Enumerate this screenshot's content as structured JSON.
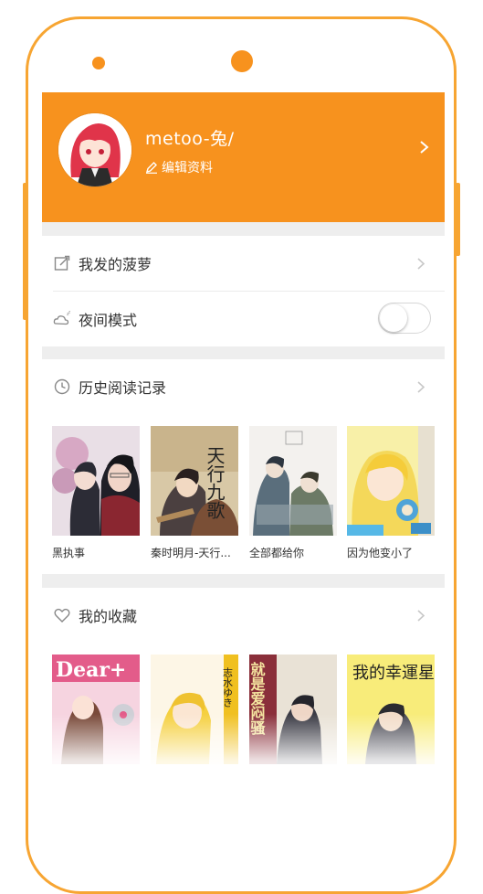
{
  "profile": {
    "username": "metoo-兔/",
    "edit_label": "编辑资料"
  },
  "menu": {
    "my_posts": "我发的菠萝",
    "night_mode": "夜间模式",
    "night_mode_on": false
  },
  "history": {
    "title": "历史阅读记录",
    "books": [
      {
        "title": "黑执事",
        "cover_text": ""
      },
      {
        "title": "秦时明月-天行...",
        "cover_text": "天行九歌"
      },
      {
        "title": "全部都给你",
        "cover_text": ""
      },
      {
        "title": "因为他变小了",
        "cover_text": ""
      }
    ]
  },
  "favorites": {
    "title": "我的收藏",
    "books": [
      {
        "cover_text": "Dear+"
      },
      {
        "cover_text": "志水ゆき"
      },
      {
        "cover_text": "就是爱闷骚"
      },
      {
        "cover_text": "我的幸運星"
      }
    ]
  },
  "colors": {
    "accent": "#f7921e",
    "frame": "#f7a532"
  }
}
